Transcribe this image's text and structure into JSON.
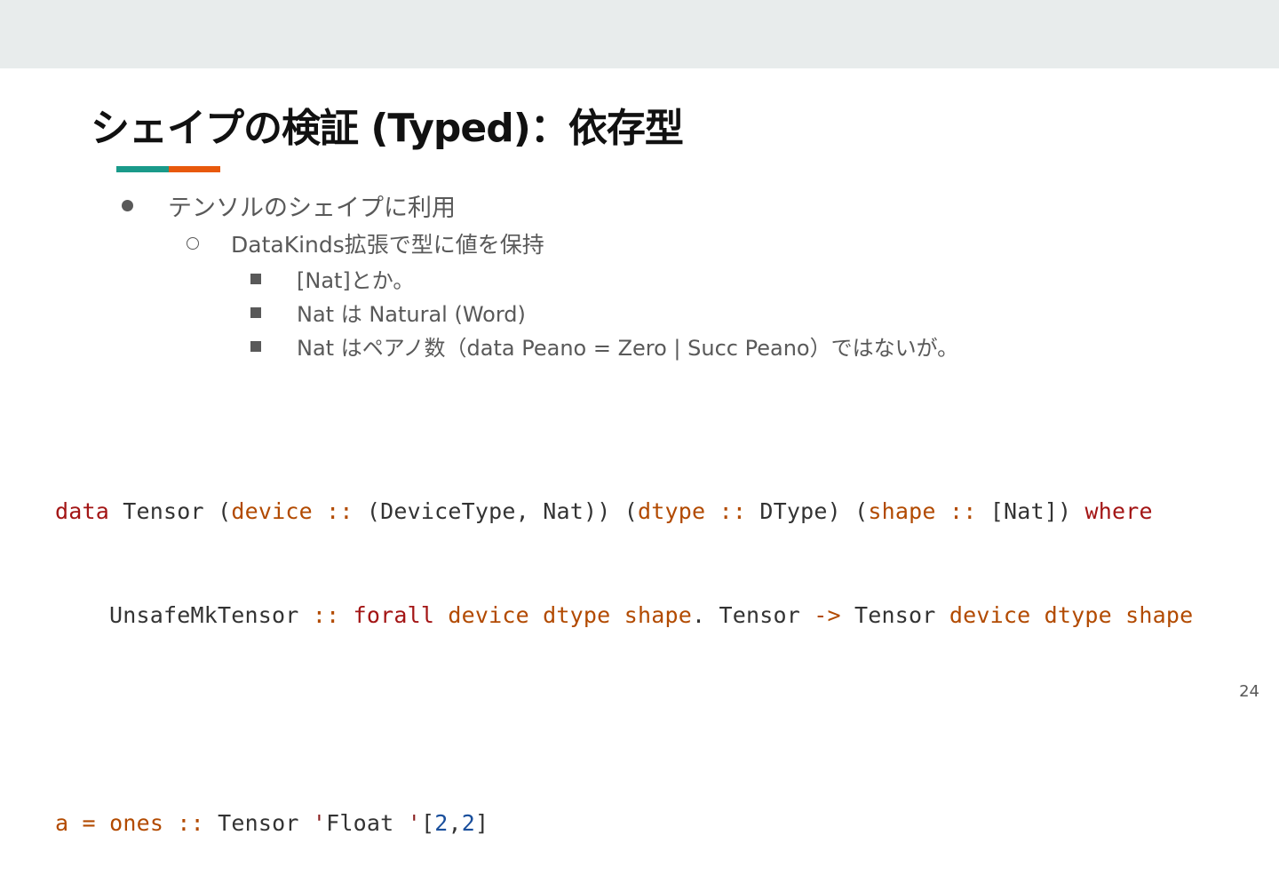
{
  "slide": {
    "title": "シェイプの検証 (Typed)：依存型",
    "accent_colors": [
      "#1a9a8a",
      "#e8590c"
    ],
    "page_number": "24"
  },
  "bullets": {
    "level1": "テンソルのシェイプに利用",
    "level2": "DataKinds拡張で型に値を保持",
    "level3": [
      "[Nat]とか。",
      "Nat は Natural (Word)",
      "Nat はペアノ数（data Peano = Zero | Succ Peano）ではないが。"
    ]
  },
  "code": {
    "language": "haskell",
    "lines": [
      "data Tensor (device :: (DeviceType, Nat)) (dtype :: DType) (shape :: [Nat]) where",
      "    UnsafeMkTensor :: forall device dtype shape. Tensor -> Tensor device dtype shape",
      "",
      "a = ones :: Tensor 'Float '[2,2]"
    ]
  }
}
